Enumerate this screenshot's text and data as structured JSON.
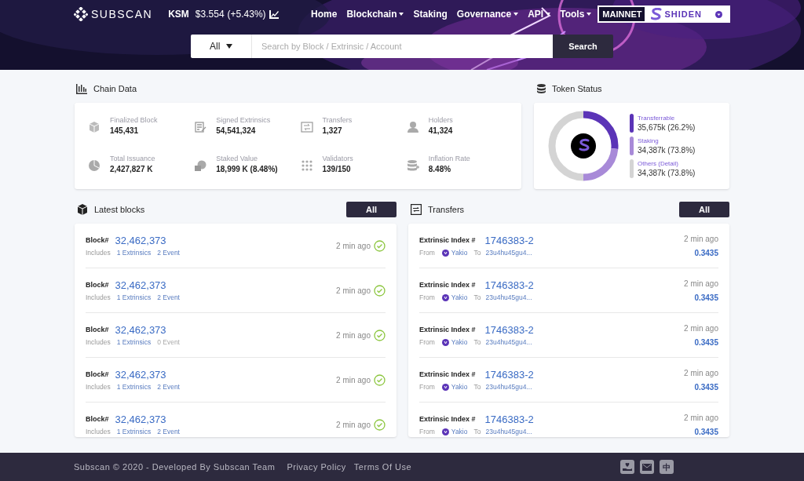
{
  "header": {
    "logo": "SUBSCAN",
    "token": "KSM",
    "price": "$3.554",
    "change": "(+5.43%)",
    "nav": [
      {
        "label": "Home",
        "dropdown": false
      },
      {
        "label": "Blockchain",
        "dropdown": true
      },
      {
        "label": "Staking",
        "dropdown": false
      },
      {
        "label": "Governance",
        "dropdown": true
      },
      {
        "label": "API",
        "dropdown": true
      },
      {
        "label": "Tools",
        "dropdown": true
      }
    ],
    "network": {
      "mainnet": "MAINNET",
      "name": "SHIDEN"
    }
  },
  "search": {
    "filter": "All",
    "placeholder": "Search by Block / Extrinsic / Account",
    "button": "Search"
  },
  "chain_data": {
    "title": "Chain Data",
    "stats": [
      {
        "kind": "block",
        "label": "Finalized Block",
        "value": "145,431"
      },
      {
        "kind": "extrinsics",
        "label": "Signed Extrinsics",
        "value": "54,541,324"
      },
      {
        "kind": "transfers",
        "label": "Transfers",
        "value": "1,327"
      },
      {
        "kind": "holders",
        "label": "Holders",
        "value": "41,324"
      },
      {
        "kind": "issuance",
        "label": "Total Issuance",
        "value": "2,427,827 K"
      },
      {
        "kind": "staked",
        "label": "Staked Value",
        "value": "18,999 K (8.48%)"
      },
      {
        "kind": "validators",
        "label": "Validators",
        "value": "139/150"
      },
      {
        "kind": "inflation",
        "label": "Inflation Rate",
        "value": "8.48%"
      }
    ]
  },
  "token_status": {
    "title": "Token Status",
    "legend": [
      {
        "label": "Transferrable",
        "value": "35,675k (26.2%)",
        "color": "#5b34b7"
      },
      {
        "label": "Staking",
        "value": "34,387k (73.8%)",
        "color": "#a88ad8"
      },
      {
        "label": "Others (Detail)",
        "value": "34,387k (73.8%)",
        "color": "#d4d4d4"
      }
    ]
  },
  "latest_blocks": {
    "title": "Latest blocks",
    "button": "All",
    "rows": [
      {
        "label": "Block#",
        "number": "32,462,373",
        "includes": "Includes",
        "extrinsics": "1 Extrinsics",
        "events": "2 Event",
        "events_linked": true,
        "time": "2 min ago"
      },
      {
        "label": "Block#",
        "number": "32,462,373",
        "includes": "Includes",
        "extrinsics": "1 Extrinsics",
        "events": "2 Event",
        "events_linked": true,
        "time": "2 min ago"
      },
      {
        "label": "Block#",
        "number": "32,462,373",
        "includes": "Includes",
        "extrinsics": "1 Extrinsics",
        "events": "0 Event",
        "events_linked": false,
        "time": "2 min ago"
      },
      {
        "label": "Block#",
        "number": "32,462,373",
        "includes": "Includes",
        "extrinsics": "1 Extrinsics",
        "events": "2 Event",
        "events_linked": true,
        "time": "2 min ago"
      },
      {
        "label": "Block#",
        "number": "32,462,373",
        "includes": "Includes",
        "extrinsics": "1 Extrinsics",
        "events": "2 Event",
        "events_linked": true,
        "time": "2 min ago"
      }
    ]
  },
  "transfers": {
    "title": "Transfers",
    "button": "All",
    "rows": [
      {
        "label": "Extrinsic Index #",
        "index": "1746383-2",
        "from_label": "From",
        "from": "Yakio",
        "to_label": "To",
        "to": "23u4hu45gu4...",
        "time": "2 min ago",
        "amount": "0.3435"
      },
      {
        "label": "Extrinsic Index #",
        "index": "1746383-2",
        "from_label": "From",
        "from": "Yakio",
        "to_label": "To",
        "to": "23u4hu45gu4...",
        "time": "2 min ago",
        "amount": "0.3435"
      },
      {
        "label": "Extrinsic Index #",
        "index": "1746383-2",
        "from_label": "From",
        "from": "Yakio",
        "to_label": "To",
        "to": "23u4hu45gu4...",
        "time": "2 min ago",
        "amount": "0.3435"
      },
      {
        "label": "Extrinsic Index #",
        "index": "1746383-2",
        "from_label": "From",
        "from": "Yakio",
        "to_label": "To",
        "to": "23u4hu45gu4...",
        "time": "2 min ago",
        "amount": "0.3435"
      },
      {
        "label": "Extrinsic Index #",
        "index": "1746383-2",
        "from_label": "From",
        "from": "Yakio",
        "to_label": "To",
        "to": "23u4hu45gu4...",
        "time": "2 min ago",
        "amount": "0.3435"
      }
    ]
  },
  "footer": {
    "copyright": "Subscan © 2020 - Developed By Subscan Team",
    "links": [
      "Privacy Policy",
      "Terms Of Use"
    ],
    "language": "中"
  }
}
